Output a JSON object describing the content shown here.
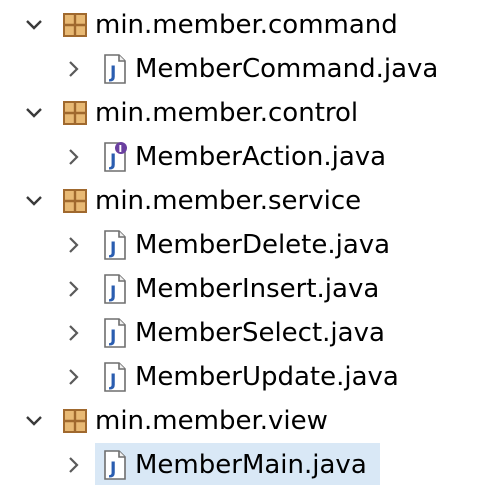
{
  "colors": {
    "package_brown": "#a0692e",
    "package_fill": "#e8b974",
    "java_blue": "#2a5db0",
    "selection": "#d9e8f6",
    "interface_badge": "#6a3fa0"
  },
  "tree": [
    {
      "kind": "package",
      "expanded": true,
      "label": "min.member.command"
    },
    {
      "kind": "file",
      "label": "MemberCommand.java",
      "icon": "java-class-icon"
    },
    {
      "kind": "package",
      "expanded": true,
      "label": "min.member.control"
    },
    {
      "kind": "file",
      "label": "MemberAction.java",
      "icon": "java-interface-icon"
    },
    {
      "kind": "package",
      "expanded": true,
      "label": "min.member.service"
    },
    {
      "kind": "file",
      "label": "MemberDelete.java",
      "icon": "java-class-icon"
    },
    {
      "kind": "file",
      "label": "MemberInsert.java",
      "icon": "java-class-icon"
    },
    {
      "kind": "file",
      "label": "MemberSelect.java",
      "icon": "java-class-icon"
    },
    {
      "kind": "file",
      "label": "MemberUpdate.java",
      "icon": "java-class-icon"
    },
    {
      "kind": "package",
      "expanded": true,
      "label": "min.member.view"
    },
    {
      "kind": "file",
      "label": "MemberMain.java",
      "icon": "java-class-icon",
      "selected": true
    }
  ]
}
